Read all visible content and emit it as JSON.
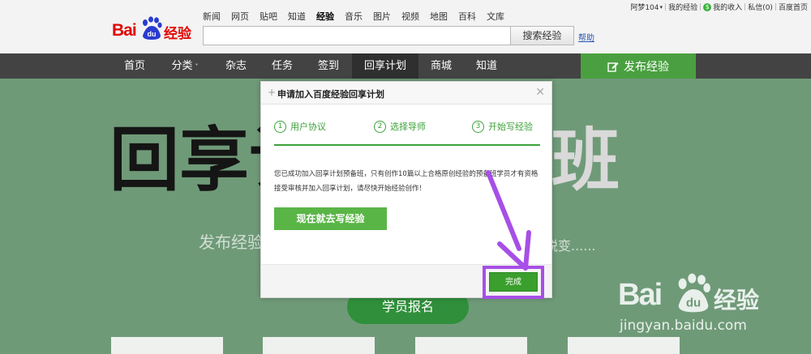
{
  "header": {
    "logo": {
      "text_bai": "Bai",
      "text_du": "du",
      "text_cn": "经验"
    },
    "topnav": [
      "新闻",
      "网页",
      "贴吧",
      "知道",
      "经验",
      "音乐",
      "图片",
      "视频",
      "地图",
      "百科",
      "文库"
    ],
    "topnav_active": "经验",
    "search": {
      "value": "",
      "button_label": "搜索经验"
    },
    "help_label": "帮助",
    "userbar": {
      "username": "阿梦104",
      "my_experience": "我的经验",
      "my_income": "我的收入",
      "messages": "私信(0)",
      "baidu_home": "百度首页"
    }
  },
  "mainnav": {
    "items": [
      "首页",
      "分类",
      "杂志",
      "任务",
      "签到",
      "回享计划",
      "商城",
      "知道"
    ],
    "selected": "回享计划",
    "publish_label": "发布经验"
  },
  "page": {
    "calligraphy_left": "回享计",
    "calligraphy_right": "班",
    "bg_text_left": "发布经验",
    "bg_text_right": "蜕变......",
    "enroll_label": "学员报名",
    "watermark": {
      "bai": "Bai",
      "du": "du",
      "cn": "经验",
      "url": "jingyan.baidu.com"
    }
  },
  "modal": {
    "title": "申请加入百度经验回享计划",
    "steps": [
      {
        "num": "1",
        "label": "用户协议"
      },
      {
        "num": "2",
        "label": "选择导师"
      },
      {
        "num": "3",
        "label": "开始写经验"
      }
    ],
    "message": "您已成功加入回享计划预备班，只有创作10篇以上合格原创经验的预备班学员才有资格接受审核并加入回享计划，请尽快开始经验创作！",
    "go_write_label": "现在就去写经验",
    "done_label": "完成"
  },
  "colors": {
    "brand_red": "#e10602",
    "green": "#3da23a",
    "highlight": "#a74fe6",
    "nav_dark": "#434343"
  }
}
